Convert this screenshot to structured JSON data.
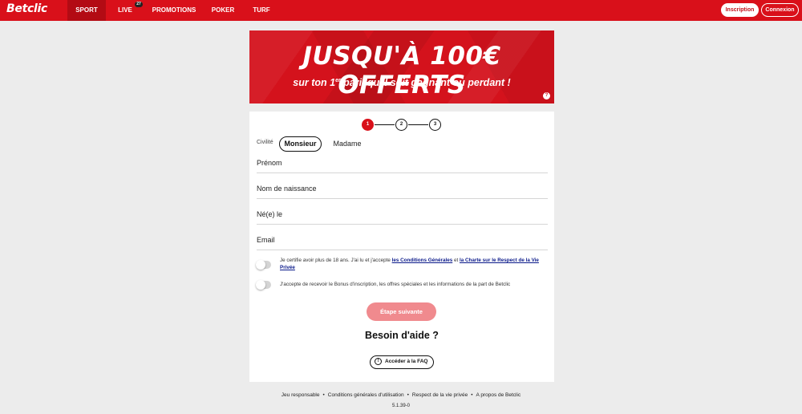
{
  "header": {
    "logo": "Betclic",
    "nav": [
      "SPORT",
      "LIVE",
      "PROMOTIONS",
      "POKER",
      "TURF"
    ],
    "live_count": "27",
    "inscription_label": "Inscription",
    "connexion_label": "Connexion",
    "brand_color": "#d9101a"
  },
  "banner": {
    "title": "JUSQU'À 100€ OFFERTS",
    "subtitle_pre": "sur ton 1",
    "subtitle_sup": "er",
    "subtitle_post": " pari, qu'il soit gagnant ou perdant !",
    "help_icon": "?"
  },
  "steps": [
    "1",
    "2",
    "3"
  ],
  "form": {
    "civility_label": "Civilité",
    "civility_options": [
      "Monsieur",
      "Madame"
    ],
    "fields": [
      "Prénom",
      "Nom de naissance",
      "Né(e) le",
      "Email"
    ],
    "consent_1_pre": "Je certifie avoir plus de 18 ans. J'ai lu et j'accepte ",
    "consent_1_link1": "les Conditions Générales",
    "consent_1_mid": " et ",
    "consent_1_link2": "la Charte sur le Respect de la Vie Privée",
    "consent_2": "J'accepte de recevoir le Bonus d'inscription, les offres spéciales et les informations de la part de Betclic",
    "next_label": "Étape suivante"
  },
  "help": {
    "title": "Besoin d'aide ?",
    "faq_label": "Accéder à la FAQ"
  },
  "footer": {
    "links": [
      "Jeu responsable",
      "Conditions générales d'utilisation",
      "Respect de la vie privée",
      "A propos de Betclic"
    ],
    "separator": "•",
    "version": "5.1.39-0"
  }
}
